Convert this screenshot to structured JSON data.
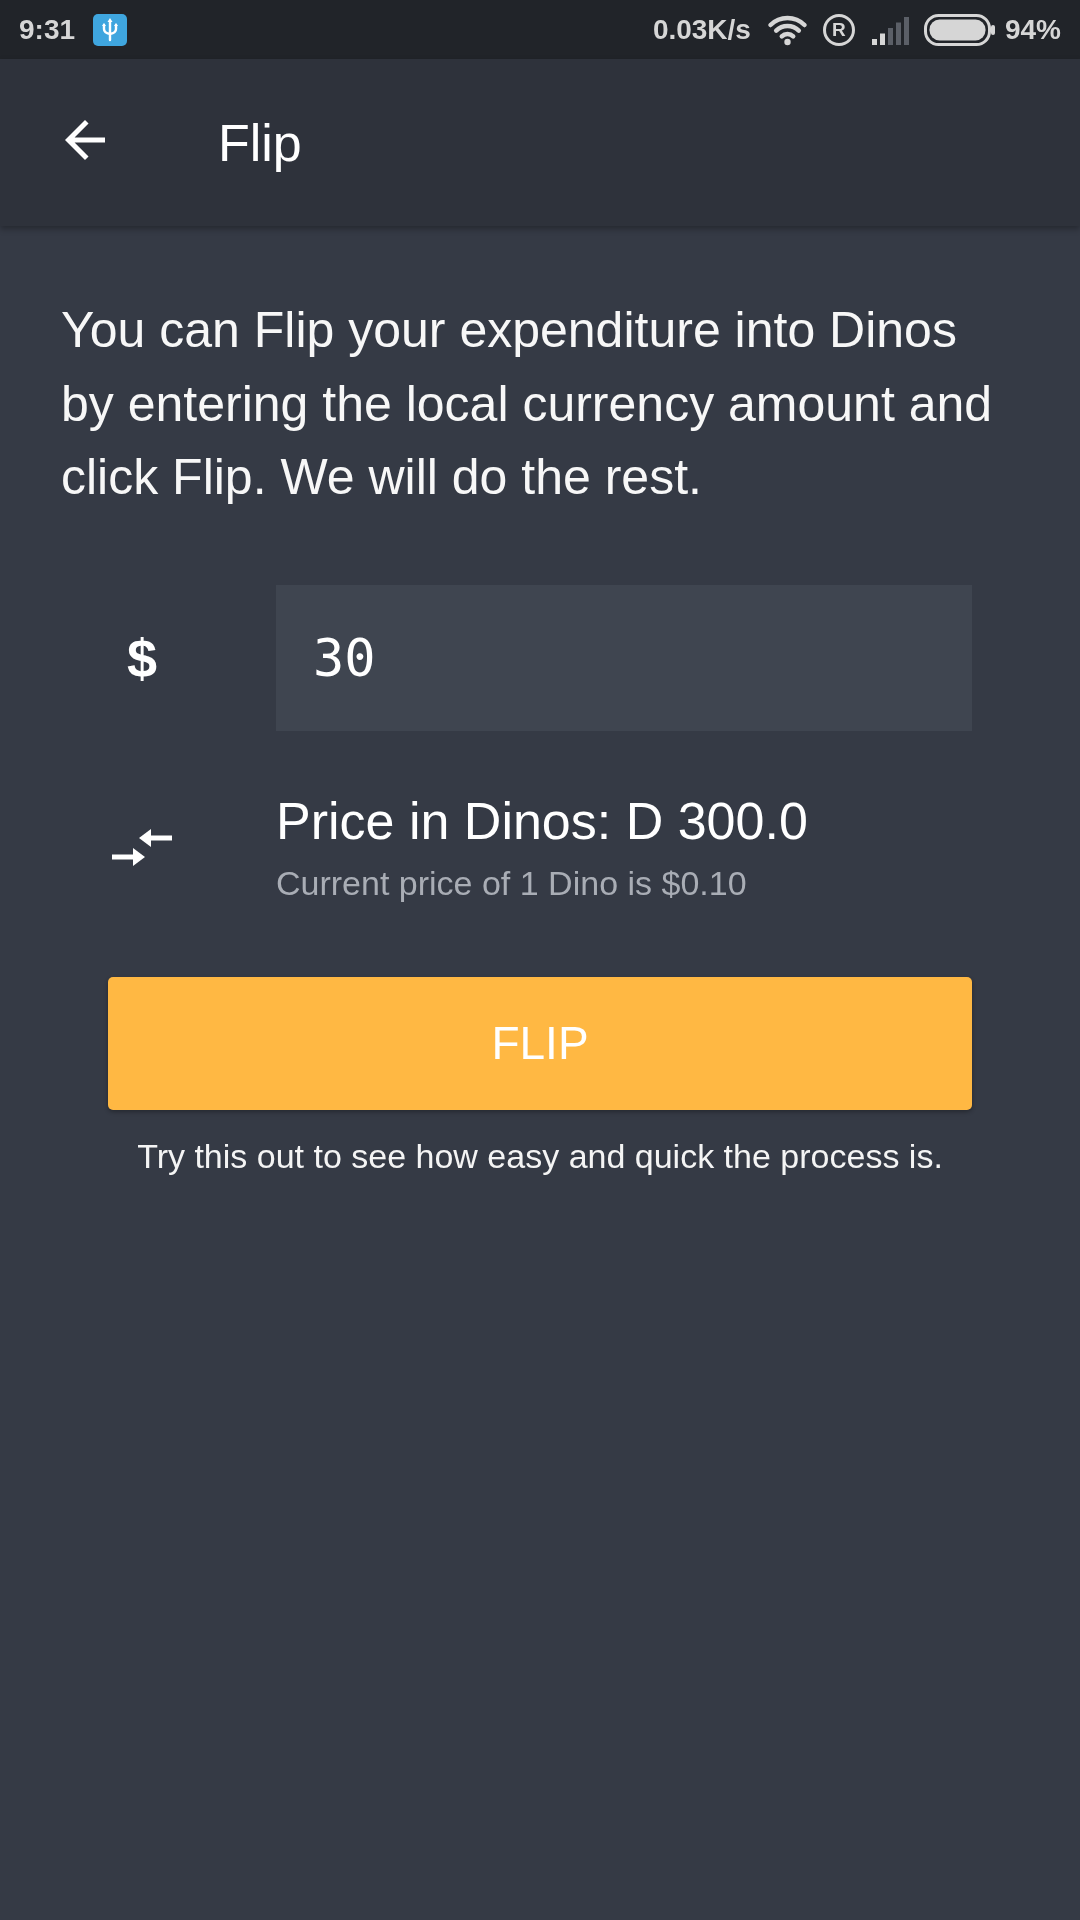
{
  "status_bar": {
    "time": "9:31",
    "network_speed": "0.03K/s",
    "roaming_indicator": "R",
    "battery_percent": "94%"
  },
  "app_bar": {
    "title": "Flip"
  },
  "intro_text": "You can Flip your expenditure into Dinos by entering the local currency amount and click Flip. We will do the rest.",
  "amount": {
    "currency_symbol": "$",
    "value": "30"
  },
  "price": {
    "title": "Price in Dinos: D 300.0",
    "subtitle": "Current price of 1 Dino is $0.10"
  },
  "flip_button": {
    "label": "FLIP"
  },
  "hint": "Try this out to see how easy and quick the process is."
}
